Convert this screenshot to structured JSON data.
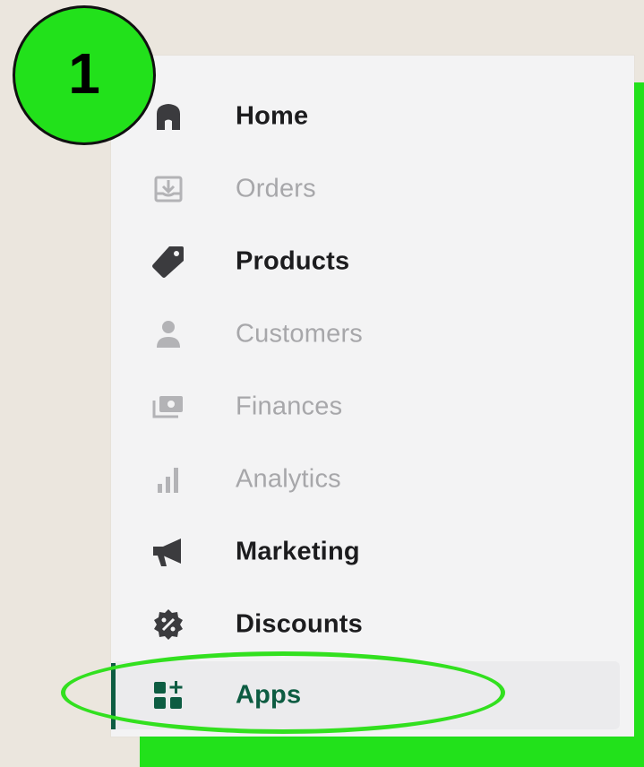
{
  "badge": {
    "number": "1"
  },
  "sidebar": {
    "items": [
      {
        "label": "Home",
        "icon": "home-icon",
        "state": "active"
      },
      {
        "label": "Orders",
        "icon": "orders-icon",
        "state": "muted"
      },
      {
        "label": "Products",
        "icon": "tag-icon",
        "state": "active"
      },
      {
        "label": "Customers",
        "icon": "person-icon",
        "state": "muted"
      },
      {
        "label": "Finances",
        "icon": "finances-icon",
        "state": "muted"
      },
      {
        "label": "Analytics",
        "icon": "bar-chart-icon",
        "state": "muted"
      },
      {
        "label": "Marketing",
        "icon": "megaphone-icon",
        "state": "active"
      },
      {
        "label": "Discounts",
        "icon": "discount-badge-icon",
        "state": "active"
      },
      {
        "label": "Apps",
        "icon": "apps-add-icon",
        "state": "selected"
      }
    ]
  },
  "colors": {
    "highlight": "#22e11b",
    "apps_accent": "#0d5c42",
    "active_text": "#1c1c1e",
    "muted_text": "#a7a7aa",
    "background": "#ebe6de"
  }
}
